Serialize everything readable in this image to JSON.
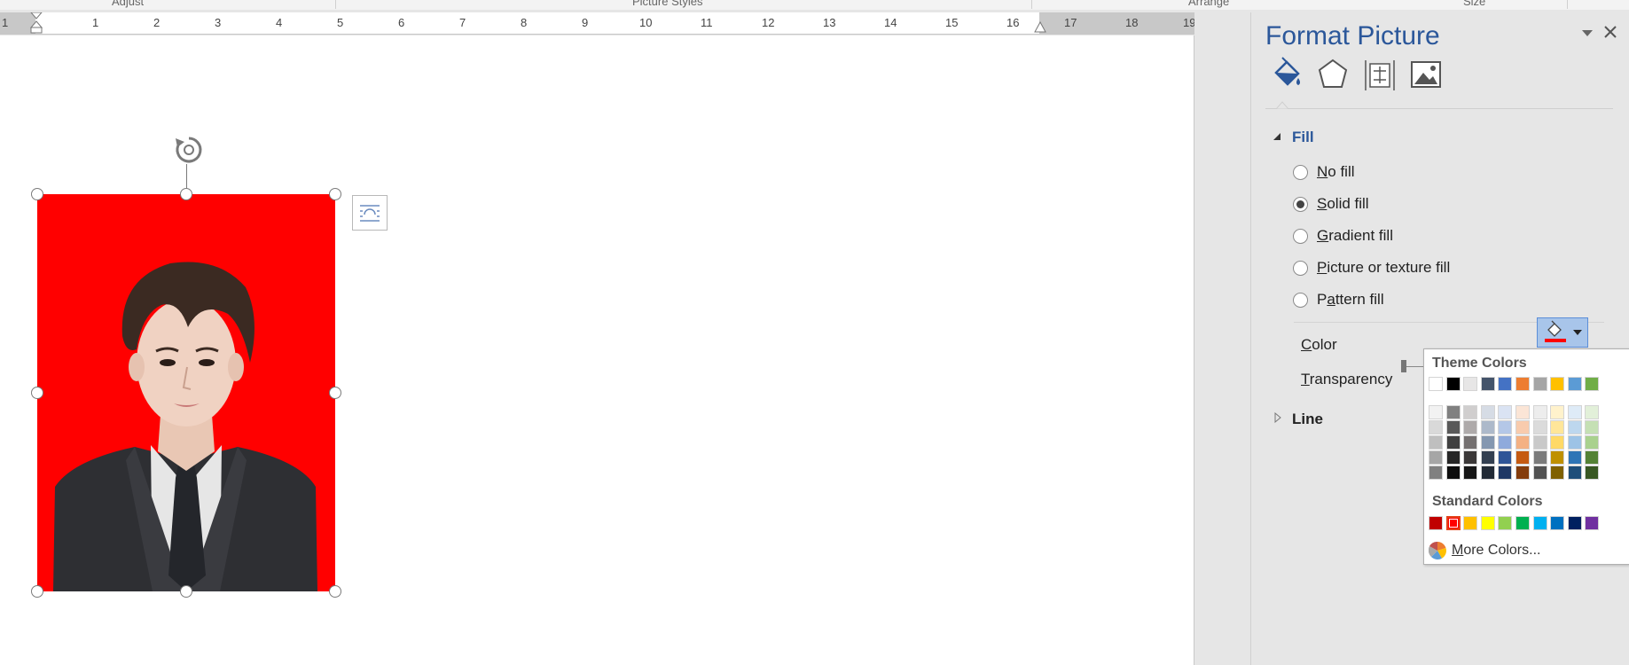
{
  "ribbon": {
    "groups": [
      "Adjust",
      "Picture Styles",
      "Arrange",
      "Size"
    ]
  },
  "ruler": {
    "numbers": [
      "1",
      "1",
      "2",
      "3",
      "4",
      "5",
      "6",
      "7",
      "8",
      "9",
      "10",
      "11",
      "12",
      "13",
      "14",
      "15",
      "16",
      "17",
      "18",
      "19"
    ]
  },
  "document": {
    "picture_background": "#ff0000"
  },
  "pane": {
    "title": "Format Picture",
    "tabs": [
      {
        "icon": "fill-line-icon"
      },
      {
        "icon": "effects-icon"
      },
      {
        "icon": "size-properties-icon"
      },
      {
        "icon": "picture-icon"
      }
    ],
    "fill_section": {
      "label": "Fill",
      "options": [
        {
          "label": "No fill",
          "checked": false
        },
        {
          "label": "Solid fill",
          "checked": true
        },
        {
          "label": "Gradient fill",
          "checked": false
        },
        {
          "label": "Picture or texture fill",
          "checked": false
        },
        {
          "label": "Pattern fill",
          "checked": false
        }
      ],
      "color_label": "Color",
      "transparency_label": "Transparency"
    },
    "line_section": {
      "label": "Line"
    }
  },
  "palette": {
    "theme_heading": "Theme Colors",
    "standard_heading": "Standard Colors",
    "more_colors": "More Colors...",
    "theme_columns": [
      [
        "#ffffff",
        "#f2f2f2",
        "#d9d9d9",
        "#bfbfbf",
        "#a6a6a6",
        "#808080"
      ],
      [
        "#000000",
        "#808080",
        "#595959",
        "#404040",
        "#262626",
        "#0d0d0d"
      ],
      [
        "#e7e6e6",
        "#d0cece",
        "#aeaaaa",
        "#757171",
        "#3b3838",
        "#161616"
      ],
      [
        "#44546a",
        "#d6dce5",
        "#adb9ca",
        "#8497b0",
        "#333f50",
        "#222a35"
      ],
      [
        "#4472c4",
        "#dae3f3",
        "#b4c7e7",
        "#8faadc",
        "#2f5597",
        "#1f3864"
      ],
      [
        "#ed7d31",
        "#fbe5d6",
        "#f8cbad",
        "#f4b183",
        "#c55a11",
        "#843c0c"
      ],
      [
        "#a5a5a5",
        "#ededed",
        "#dbdbdb",
        "#c9c9c9",
        "#7b7b7b",
        "#525252"
      ],
      [
        "#ffc000",
        "#fff2cc",
        "#ffe699",
        "#ffd966",
        "#bf9000",
        "#7f6000"
      ],
      [
        "#5b9bd5",
        "#deebf7",
        "#bdd7ee",
        "#9dc3e6",
        "#2e75b6",
        "#1f4e79"
      ],
      [
        "#70ad47",
        "#e2f0d9",
        "#c5e0b4",
        "#a9d18e",
        "#548235",
        "#385723"
      ]
    ],
    "standard_colors": [
      "#c00000",
      "#ff0000",
      "#ffc000",
      "#ffff00",
      "#92d050",
      "#00b050",
      "#00b0f0",
      "#0070c0",
      "#002060",
      "#7030a0"
    ],
    "selected_standard": "#ff0000"
  }
}
